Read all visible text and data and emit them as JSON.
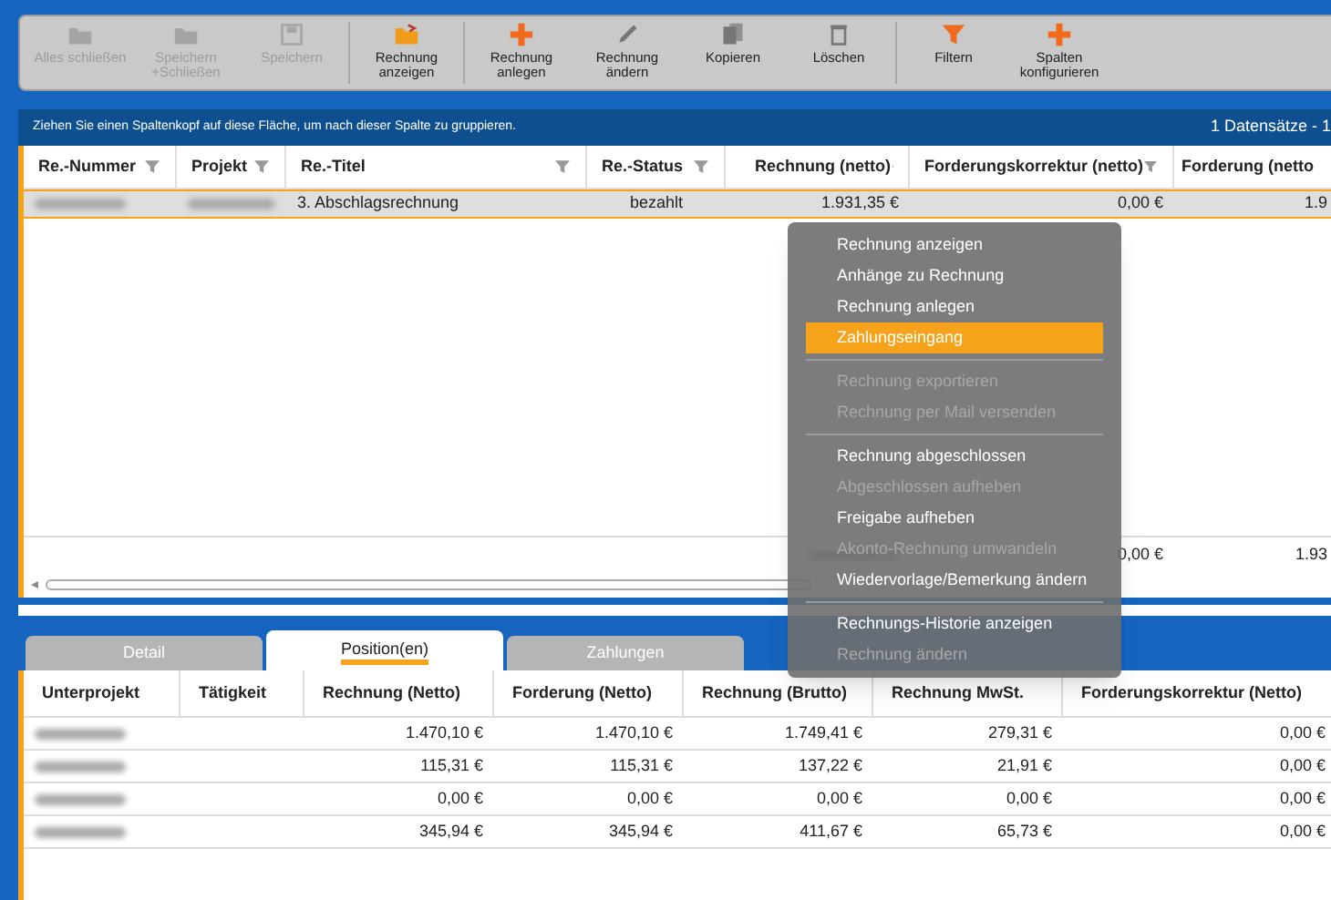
{
  "toolbar": [
    {
      "label": "Alles schließen",
      "disabled": true
    },
    {
      "label": "Speichern +Schließen",
      "disabled": true
    },
    {
      "label": "Speichern",
      "disabled": true
    },
    {
      "label": "Rechnung anzeigen",
      "disabled": false
    },
    {
      "label": "Rechnung anlegen",
      "disabled": false
    },
    {
      "label": "Rechnung ändern",
      "disabled": false
    },
    {
      "label": "Kopieren",
      "disabled": false
    },
    {
      "label": "Löschen",
      "disabled": false
    },
    {
      "label": "Filtern",
      "disabled": false
    },
    {
      "label": "Spalten konfigurieren",
      "disabled": false
    }
  ],
  "group_hint": "Ziehen Sie einen Spaltenkopf auf diese Fläche, um nach dieser Spalte zu gruppieren.",
  "record_count": "1 Datensätze - 1",
  "grid": {
    "columns": [
      "Re.-Nummer",
      "Projekt",
      "Re.-Titel",
      "Re.-Status",
      "Rechnung (netto)",
      "Forderungskorrektur (netto)",
      "Forderung (netto"
    ],
    "rows": [
      {
        "selected": true,
        "cells": [
          {
            "kind": "blurred"
          },
          {
            "kind": "blurred"
          },
          {
            "kind": "text",
            "text": "3. Abschlagsrechnung"
          },
          {
            "kind": "text",
            "text": "bezahlt"
          },
          {
            "kind": "text",
            "text": "1.931,35 €"
          },
          {
            "kind": "text",
            "text": "0,00 €"
          },
          {
            "kind": "text",
            "text": "1.9"
          }
        ]
      }
    ],
    "totals": [
      {
        "kind": "empty"
      },
      {
        "kind": "empty"
      },
      {
        "kind": "empty"
      },
      {
        "kind": "empty"
      },
      {
        "kind": "blurred"
      },
      {
        "kind": "text",
        "text": "0,00 €"
      },
      {
        "kind": "text",
        "text": "1.93"
      }
    ]
  },
  "tabs": [
    {
      "label": "Detail",
      "selected": false
    },
    {
      "label": "Position(en)",
      "selected": true
    },
    {
      "label": "Zahlungen",
      "selected": false
    }
  ],
  "positions": {
    "columns": [
      "Unterprojekt",
      "Tätigkeit",
      "Rechnung (Netto)",
      "Forderung (Netto)",
      "Rechnung (Brutto)",
      "Rechnung MwSt.",
      "Forderungskorrektur (Netto)"
    ],
    "rows": [
      {
        "cells": [
          {
            "kind": "blurred"
          },
          {
            "kind": "empty"
          },
          {
            "kind": "text",
            "text": "1.470,10 €"
          },
          {
            "kind": "text",
            "text": "1.470,10 €"
          },
          {
            "kind": "text",
            "text": "1.749,41 €"
          },
          {
            "kind": "text",
            "text": "279,31 €"
          },
          {
            "kind": "text",
            "text": "0,00 €"
          }
        ]
      },
      {
        "cells": [
          {
            "kind": "blurred"
          },
          {
            "kind": "empty"
          },
          {
            "kind": "text",
            "text": "115,31 €"
          },
          {
            "kind": "text",
            "text": "115,31 €"
          },
          {
            "kind": "text",
            "text": "137,22 €"
          },
          {
            "kind": "text",
            "text": "21,91 €"
          },
          {
            "kind": "text",
            "text": "0,00 €"
          }
        ]
      },
      {
        "cells": [
          {
            "kind": "blurred"
          },
          {
            "kind": "empty"
          },
          {
            "kind": "text",
            "text": "0,00 €"
          },
          {
            "kind": "text",
            "text": "0,00 €"
          },
          {
            "kind": "text",
            "text": "0,00 €"
          },
          {
            "kind": "text",
            "text": "0,00 €"
          },
          {
            "kind": "text",
            "text": "0,00 €"
          }
        ]
      },
      {
        "cells": [
          {
            "kind": "blurred"
          },
          {
            "kind": "empty"
          },
          {
            "kind": "text",
            "text": "345,94 €"
          },
          {
            "kind": "text",
            "text": "345,94 €"
          },
          {
            "kind": "text",
            "text": "411,67 €"
          },
          {
            "kind": "text",
            "text": "65,73 €"
          },
          {
            "kind": "text",
            "text": "0,00 €"
          }
        ]
      }
    ]
  },
  "context_menu": [
    {
      "label": "Rechnung anzeigen",
      "disabled": false,
      "selected": false,
      "separator_before": false
    },
    {
      "label": "Anhänge zu Rechnung",
      "disabled": false,
      "selected": false,
      "separator_before": false
    },
    {
      "label": "Rechnung anlegen",
      "disabled": false,
      "selected": false,
      "separator_before": false
    },
    {
      "label": "Zahlungseingang",
      "disabled": false,
      "selected": true,
      "separator_before": false
    },
    {
      "label": "Rechnung exportieren",
      "disabled": true,
      "selected": false,
      "separator_before": true
    },
    {
      "label": "Rechnung per Mail versenden",
      "disabled": true,
      "selected": false,
      "separator_before": false
    },
    {
      "label": "Rechnung abgeschlossen",
      "disabled": false,
      "selected": false,
      "separator_before": true
    },
    {
      "label": "Abgeschlossen aufheben",
      "disabled": true,
      "selected": false,
      "separator_before": false
    },
    {
      "label": "Freigabe aufheben",
      "disabled": false,
      "selected": false,
      "separator_before": false
    },
    {
      "label": "Akonto-Rechnung umwandeln",
      "disabled": true,
      "selected": false,
      "separator_before": false
    },
    {
      "label": "Wiedervorlage/Bemerkung ändern",
      "disabled": false,
      "selected": false,
      "separator_before": false
    },
    {
      "label": "Rechnungs-Historie anzeigen",
      "disabled": false,
      "selected": false,
      "separator_before": true
    },
    {
      "label": "Rechnung ändern",
      "disabled": true,
      "selected": false,
      "separator_before": false
    }
  ]
}
